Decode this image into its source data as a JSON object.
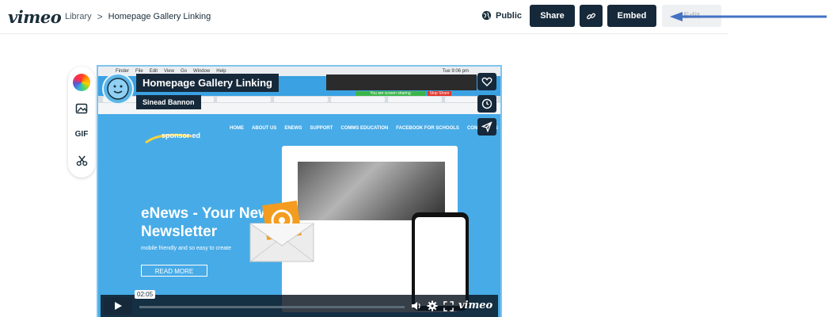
{
  "header": {
    "logo": "vimeo",
    "breadcrumb": {
      "library": "Library",
      "separator": ">",
      "current": "Homepage Gallery Linking"
    },
    "privacy_label": "Public",
    "share_label": "Share",
    "embed_label": "Embed",
    "ghost_label": "Edit"
  },
  "tools": {
    "gif_label": "GIF"
  },
  "video": {
    "title": "Homepage Gallery Linking",
    "author": "Sinead Bannon",
    "time_tooltip": "02:05",
    "player_logo": "vimeo",
    "frame": {
      "headline_line1": "eNews - Your New",
      "headline_line2": "Newsletter",
      "subtext": "mobile friendly and so easy to create",
      "button": "READ MORE",
      "nav": [
        "HOME",
        "ABOUT US",
        "ENEWS",
        "SUPPORT",
        "COMMS EDUCATION",
        "FACEBOOK FOR SCHOOLS",
        "CONTACT US"
      ],
      "brand": "sponsor-ed",
      "sharing_notice": "You are screen sharing",
      "stop_share": "Stop Share",
      "menubar_items": [
        "Finder",
        "File",
        "Edit",
        "View",
        "Go",
        "Window",
        "Help"
      ],
      "clock": "Tue 9:06 pm"
    }
  },
  "colors": {
    "accent": "#16293a",
    "video_bg": "#3aa1e2",
    "arrow": "#4472c4"
  }
}
